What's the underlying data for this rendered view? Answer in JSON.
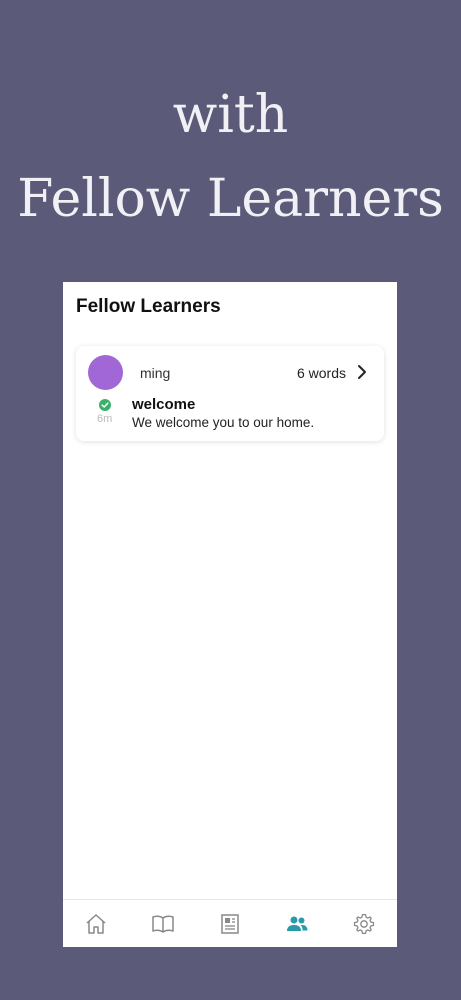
{
  "promo": {
    "line1": "with",
    "line2": "Fellow Learners"
  },
  "screen": {
    "title": "Fellow Learners"
  },
  "feed": [
    {
      "user": "ming",
      "word_count": "6 words",
      "time": "6m",
      "title": "welcome",
      "text": "We welcome you to our home.",
      "status": "check-circle-icon"
    }
  ],
  "tabs": [
    {
      "icon": "home-icon",
      "active": false
    },
    {
      "icon": "book-icon",
      "active": false
    },
    {
      "icon": "newspaper-icon",
      "active": false
    },
    {
      "icon": "people-icon",
      "active": true
    },
    {
      "icon": "gear-icon",
      "active": false
    }
  ],
  "colors": {
    "background": "#5b5a78",
    "avatar": "#a167d6",
    "accent": "#2a9aa8",
    "check": "#3ab06b"
  }
}
